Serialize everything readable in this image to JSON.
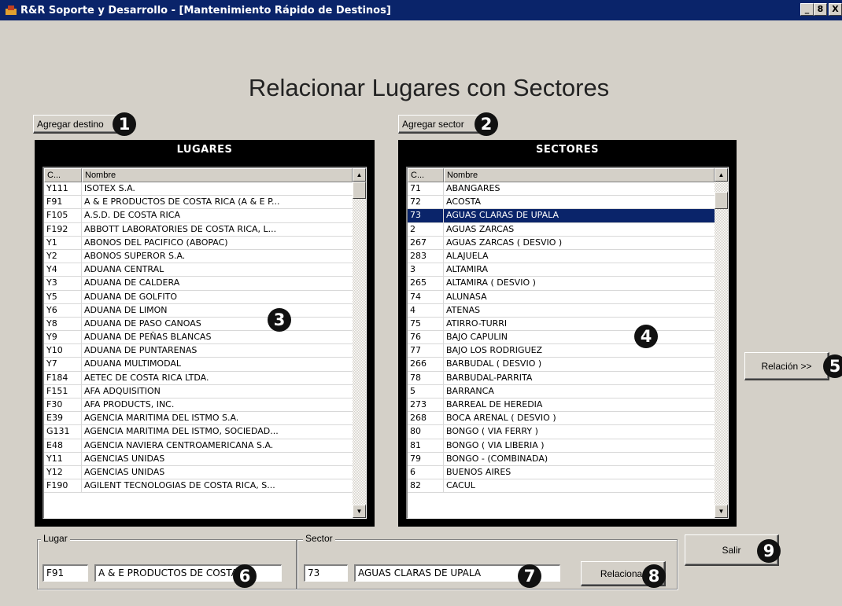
{
  "window": {
    "title": "R&R Soporte y Desarrollo - [Mantenimiento Rápido de Destinos]",
    "minimize": "_",
    "restore": "8",
    "close": "X"
  },
  "heading": "Relacionar Lugares con Sectores",
  "buttons": {
    "add_destino": "Agregar destino",
    "add_sector": "Agregar sector",
    "relacion": "Relación >>",
    "salir": "Salir",
    "relacionar": "Relacionar"
  },
  "badges": [
    "1",
    "2",
    "3",
    "4",
    "5",
    "6",
    "7",
    "8",
    "9"
  ],
  "lugares": {
    "title": "LUGARES",
    "col_code": "C...",
    "col_name": "Nombre",
    "rows": [
      {
        "code": "Y111",
        "name": "ISOTEX S.A."
      },
      {
        "code": "F91",
        "name": "A & E PRODUCTOS DE COSTA RICA (A & E P..."
      },
      {
        "code": "F105",
        "name": "A.S.D. DE COSTA RICA"
      },
      {
        "code": "F192",
        "name": "ABBOTT LABORATORIES DE COSTA RICA, L..."
      },
      {
        "code": "Y1",
        "name": "ABONOS DEL PACIFICO (ABOPAC)"
      },
      {
        "code": "Y2",
        "name": "ABONOS SUPEROR S.A."
      },
      {
        "code": "Y4",
        "name": "ADUANA CENTRAL"
      },
      {
        "code": "Y3",
        "name": "ADUANA DE CALDERA"
      },
      {
        "code": "Y5",
        "name": "ADUANA DE GOLFITO"
      },
      {
        "code": "Y6",
        "name": "ADUANA DE LIMON"
      },
      {
        "code": "Y8",
        "name": "ADUANA DE PASO CANOAS"
      },
      {
        "code": "Y9",
        "name": "ADUANA DE PEÑAS BLANCAS"
      },
      {
        "code": "Y10",
        "name": "ADUANA DE PUNTARENAS"
      },
      {
        "code": "Y7",
        "name": "ADUANA MULTIMODAL"
      },
      {
        "code": "F184",
        "name": "AETEC DE COSTA RICA LTDA."
      },
      {
        "code": "F151",
        "name": "AFA ADQUISITION"
      },
      {
        "code": "F30",
        "name": "AFA PRODUCTS, INC."
      },
      {
        "code": "E39",
        "name": "AGENCIA MARITIMA DEL ISTMO S.A."
      },
      {
        "code": "G131",
        "name": "AGENCIA MARITIMA DEL ISTMO, SOCIEDAD..."
      },
      {
        "code": "E48",
        "name": "AGENCIA NAVIERA CENTROAMERICANA S.A."
      },
      {
        "code": "Y11",
        "name": "AGENCIAS UNIDAS"
      },
      {
        "code": "Y12",
        "name": "AGENCIAS UNIDAS"
      },
      {
        "code": "F190",
        "name": "AGILENT TECNOLOGIAS DE COSTA RICA, S..."
      }
    ]
  },
  "sectores": {
    "title": "SECTORES",
    "col_code": "C...",
    "col_name": "Nombre",
    "selected_code": "73",
    "rows": [
      {
        "code": "71",
        "name": "ABANGARES"
      },
      {
        "code": "72",
        "name": "ACOSTA"
      },
      {
        "code": "73",
        "name": "AGUAS CLARAS DE UPALA"
      },
      {
        "code": "2",
        "name": "AGUAS ZARCAS"
      },
      {
        "code": "267",
        "name": "AGUAS ZARCAS ( DESVIO )"
      },
      {
        "code": "283",
        "name": "ALAJUELA"
      },
      {
        "code": "3",
        "name": "ALTAMIRA"
      },
      {
        "code": "265",
        "name": "ALTAMIRA ( DESVIO )"
      },
      {
        "code": "74",
        "name": "ALUNASA"
      },
      {
        "code": "4",
        "name": "ATENAS"
      },
      {
        "code": "75",
        "name": "ATIRRO-TURRI"
      },
      {
        "code": "76",
        "name": "BAJO CAPULIN"
      },
      {
        "code": "77",
        "name": "BAJO LOS RODRIGUEZ"
      },
      {
        "code": "266",
        "name": "BARBUDAL ( DESVIO )"
      },
      {
        "code": "78",
        "name": "BARBUDAL-PARRITA"
      },
      {
        "code": "5",
        "name": "BARRANCA"
      },
      {
        "code": "273",
        "name": "BARREAL DE HEREDIA"
      },
      {
        "code": "268",
        "name": "BOCA ARENAL ( DESVIO )"
      },
      {
        "code": "80",
        "name": "BONGO ( VIA FERRY )"
      },
      {
        "code": "81",
        "name": "BONGO ( VIA LIBERIA )"
      },
      {
        "code": "79",
        "name": "BONGO - (COMBINADA)"
      },
      {
        "code": "6",
        "name": "BUENOS AIRES"
      },
      {
        "code": "82",
        "name": "CACUL"
      }
    ]
  },
  "lugar_group": {
    "label": "Lugar",
    "code": "F91",
    "name": "A & E PRODUCTOS DE COSTA RI"
  },
  "sector_group": {
    "label": "Sector",
    "code": "73",
    "name": "AGUAS CLARAS DE UPALA"
  }
}
